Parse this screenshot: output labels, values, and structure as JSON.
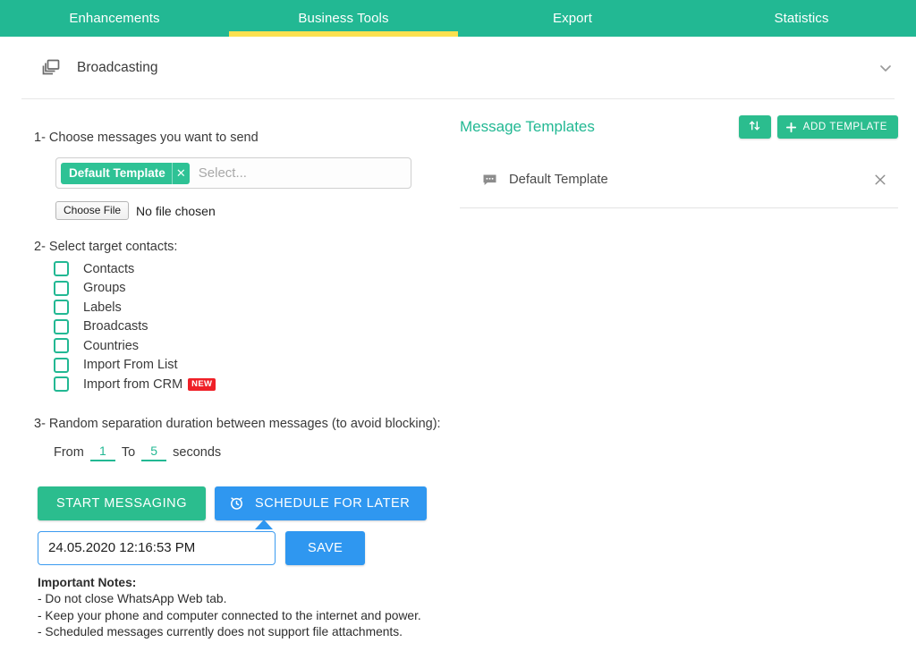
{
  "tabs": [
    {
      "label": "Enhancements",
      "active": false
    },
    {
      "label": "Business Tools",
      "active": true
    },
    {
      "label": "Export",
      "active": false
    },
    {
      "label": "Statistics",
      "active": false
    }
  ],
  "panel": {
    "title": "Broadcasting",
    "icon": "windows-stack-icon",
    "collapse_icon": "chevron-down-icon"
  },
  "left": {
    "step1_label": "1- Choose messages you want to send",
    "select": {
      "chip_label": "Default Template",
      "chip_remove_icon": "close-icon",
      "placeholder": "Select..."
    },
    "file": {
      "button_label": "Choose File",
      "status": "No file chosen"
    },
    "step2_label": "2- Select target contacts:",
    "targets": [
      {
        "label": "Contacts",
        "checked": false,
        "badge": ""
      },
      {
        "label": "Groups",
        "checked": false,
        "badge": ""
      },
      {
        "label": "Labels",
        "checked": false,
        "badge": ""
      },
      {
        "label": "Broadcasts",
        "checked": false,
        "badge": ""
      },
      {
        "label": "Countries",
        "checked": false,
        "badge": ""
      },
      {
        "label": "Import From List",
        "checked": false,
        "badge": ""
      },
      {
        "label": "Import from CRM",
        "checked": false,
        "badge": "NEW"
      }
    ],
    "step3_label": "3- Random separation duration between messages (to avoid blocking):",
    "duration": {
      "from_text": "From",
      "from_value": "1",
      "to_text": "To",
      "to_value": "5",
      "unit_text": "seconds"
    },
    "buttons": {
      "start_label": "START MESSAGING",
      "schedule_label": "SCHEDULE FOR LATER",
      "schedule_icon": "alarm-clock-icon",
      "save_label": "SAVE"
    },
    "schedule_datetime": "24.05.2020 12:16:53 PM",
    "notes": {
      "title": "Important Notes:",
      "lines": [
        "- Do not close WhatsApp Web tab.",
        "- Keep your phone and computer connected to the internet and power.",
        "- Scheduled messages currently does not support file attachments."
      ]
    }
  },
  "right": {
    "title": "Message Templates",
    "sort_icon": "sort-arrows-icon",
    "add_label": "ADD TEMPLATE",
    "add_icon": "plus-icon",
    "templates": [
      {
        "name": "Default Template",
        "icon": "chat-bubble-icon",
        "remove_icon": "close-icon"
      }
    ]
  },
  "colors": {
    "teal": "#22b893",
    "teal_button": "#2bbd8e",
    "yellow_underline": "#fbe04f",
    "blue": "#2f97f0",
    "red_badge": "#ef2027",
    "text": "#3a3a3a"
  }
}
